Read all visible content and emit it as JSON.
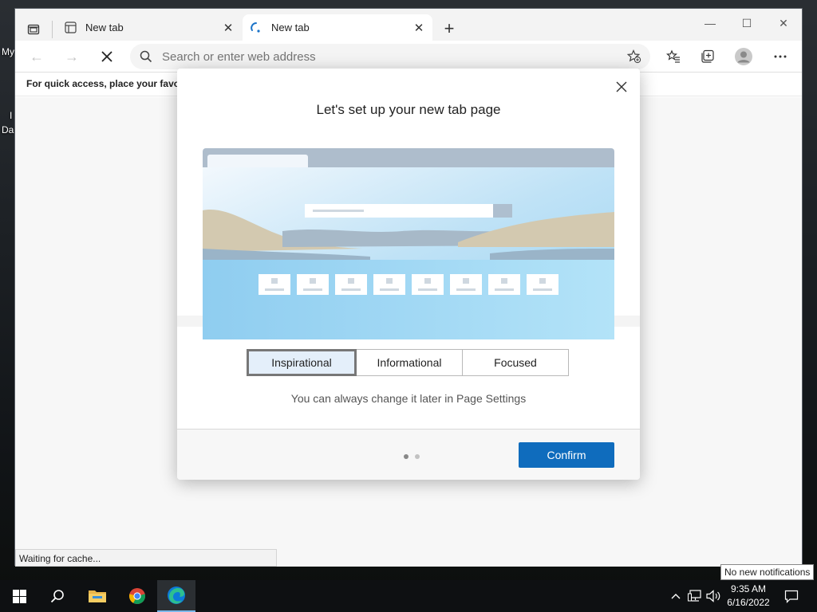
{
  "desktop": {
    "label_top": "My",
    "label_mid": "I",
    "label_bottom": "Da"
  },
  "browser": {
    "tabs": [
      {
        "title": "New tab",
        "active": false
      },
      {
        "title": "New tab",
        "active": true
      }
    ],
    "window_controls": {
      "minimize": "—",
      "maximize": "☐",
      "close": "✕"
    },
    "address": {
      "placeholder": "Search or enter web address"
    },
    "favorites_bar_text": "For quick access, place your favorit",
    "status_text": "Waiting for cache..."
  },
  "dialog": {
    "title": "Let's set up your new tab page",
    "layout_options": [
      {
        "label": "Inspirational",
        "selected": true
      },
      {
        "label": "Informational",
        "selected": false
      },
      {
        "label": "Focused",
        "selected": false
      }
    ],
    "hint": "You can always change it later in Page Settings",
    "confirm_label": "Confirm",
    "page_indicator": {
      "total": 2,
      "current": 1
    }
  },
  "taskbar": {
    "apps": [
      "start-icon",
      "search-icon",
      "file-explorer-icon",
      "chrome-icon",
      "edge-icon"
    ],
    "active_app": "edge-icon",
    "clock": {
      "time": "9:35 AM",
      "date": "6/16/2022"
    },
    "notification_tooltip": "No new notifications"
  },
  "colors": {
    "accent": "#0f6cbd",
    "selected_option_bg": "#e4effa"
  }
}
